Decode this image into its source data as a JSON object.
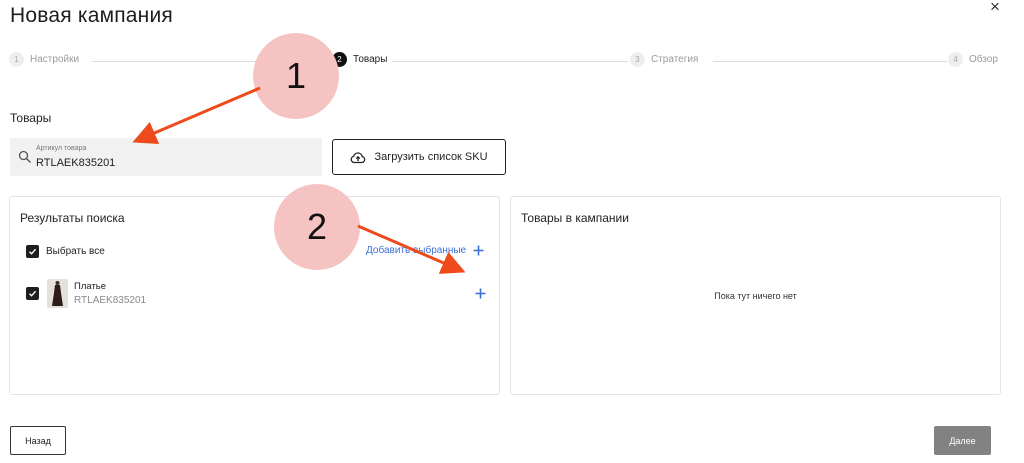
{
  "header": {
    "title": "Новая кампания",
    "close_symbol": "×"
  },
  "stepper": {
    "steps": [
      {
        "number": "1",
        "label": "Настройки",
        "state": "done"
      },
      {
        "number": "2",
        "label": "Товары",
        "state": "active"
      },
      {
        "number": "3",
        "label": "Стратегия",
        "state": "pending"
      },
      {
        "number": "4",
        "label": "Обзор",
        "state": "pending"
      }
    ]
  },
  "products": {
    "section_label": "Товары",
    "search": {
      "label": "Артикул товара",
      "value": "RTLAEK835201",
      "icon": "search-icon"
    },
    "upload_button": {
      "label": "Загрузить список SKU",
      "icon": "cloud-upload-icon"
    }
  },
  "results": {
    "title": "Результаты поиска",
    "select_all": {
      "label": "Выбрать все",
      "checked": true
    },
    "add_selected_label": "Добавить выбранные",
    "items": [
      {
        "name": "Платье",
        "sku": "RTLAEK835201",
        "checked": true
      }
    ]
  },
  "campaign": {
    "title": "Товары в кампании",
    "empty_text": "Пока тут ничего нет"
  },
  "footer": {
    "back_label": "Назад",
    "next_label": "Далее"
  },
  "annotations": {
    "callout_1": "1",
    "callout_2": "2"
  },
  "colors": {
    "accent_blue": "#3d6fd4",
    "callout_fill": "#f6c3c3",
    "arrow": "#ee4a1c",
    "next_button": "#828282"
  }
}
